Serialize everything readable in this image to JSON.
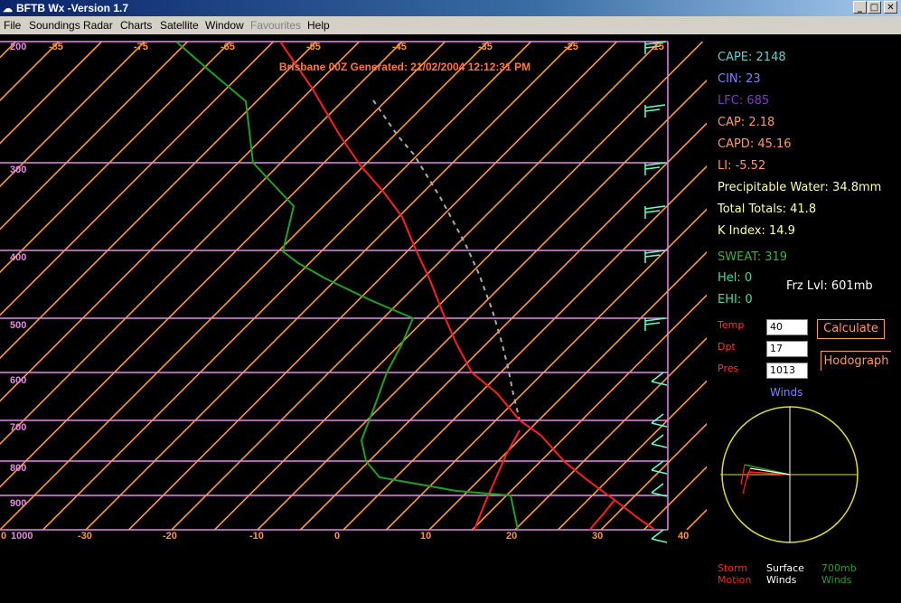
{
  "window": {
    "title": "BFTB Wx -Version 1.7",
    "app_icon": "cloud-lightning-icon",
    "controls": {
      "minimize": "_",
      "maximize": "□",
      "close": "✕"
    }
  },
  "menu": [
    "File",
    "Soundings",
    "Radar",
    "Charts",
    "Satellite",
    "Window",
    "Favourites",
    "Help"
  ],
  "menu_disabled": [
    "Favourites"
  ],
  "diagram": {
    "header": "Brisbane   00Z Generated: 21/02/2004 12:12:31 PM",
    "pressure_labels": [
      "200",
      "300",
      "400",
      "500",
      "600",
      "700",
      "800",
      "900",
      "1000"
    ],
    "pressure_levels_mb": [
      200,
      300,
      400,
      500,
      600,
      700,
      800,
      900,
      1000
    ],
    "top_temp_labels": [
      "-85",
      "-75",
      "-65",
      "-55",
      "-45",
      "-35",
      "-25",
      "-15"
    ],
    "bottom_temp_labels": [
      "0",
      "-30",
      "-20",
      "-10",
      "0",
      "10",
      "20",
      "30",
      "40"
    ],
    "isotherm_color": "#ff9933",
    "isobar_color": "#e58ae5",
    "temperature_color": "#ff2020",
    "dewpoint_color": "#22a022",
    "parcel_color": "#aaaaaa",
    "barb_color": "#66ffcc"
  },
  "indices": {
    "cape": "CAPE: 2148",
    "cin": "CIN: 23",
    "lfc": "LFC: 685",
    "cap": "CAP: 2.18",
    "capd": "CAPD: 45.16",
    "li": "LI: -5.52",
    "pw": "Precipitable Water: 34.8mm",
    "tt": "Total Totals: 41.8",
    "ki": "K Index: 14.9",
    "sweat": "SWEAT: 319",
    "hel": "Hel: 0",
    "ehi": "EHI: 0",
    "frz": "Frz Lvl: 601mb"
  },
  "inputs": {
    "temp_label": "Temp",
    "temp_value": "40",
    "dpt_label": "Dpt",
    "dpt_value": "17",
    "pres_label": "Pres",
    "pres_value": "1013"
  },
  "buttons": {
    "calculate": "Calculate",
    "hodograph": "Hodograph"
  },
  "hodograph": {
    "title": "Winds"
  },
  "legend": {
    "storm": "Storm Motion",
    "surface": "Surface Winds",
    "mb700": "700mb Winds"
  }
}
